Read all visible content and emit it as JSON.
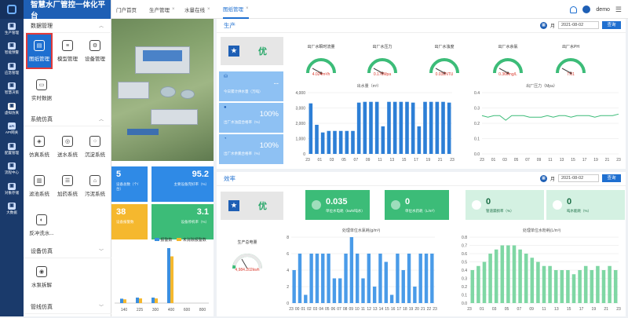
{
  "app_title": "智慧水厂管控一体化平台",
  "iconbar": [
    "生产管理",
    "智能预警",
    "应急管理",
    "智慧决策",
    "虚拟仿真",
    "API网关",
    "配置管理",
    "流程中心",
    "对象存储",
    "大数据"
  ],
  "menu": {
    "sec1": "数据管理",
    "sec1_items": [
      "图纸管理",
      "模型管理",
      "设备管理",
      "实时数据"
    ],
    "sec2": "系统仿真",
    "sec2_items": [
      "仿真系统",
      "送水系统",
      "沉淀系统",
      "滤池系统",
      "加药系统",
      "污泥系统",
      "反冲洗水..."
    ],
    "sec3": "设备仿真",
    "sec3_items": [
      "水泵拆解"
    ],
    "sec4": "管线仿真"
  },
  "tabs": [
    "门户首页",
    "生产管理",
    "水量在线",
    "图纸管理"
  ],
  "user": "demo",
  "left_cards": [
    {
      "value": "5",
      "label": "设备总数（个/台）",
      "color": "#2f8ae6"
    },
    {
      "value": "95.2",
      "label": "主要设备完好率（%）",
      "color": "#2f8ae6"
    },
    {
      "value": "38",
      "label": "设备报警数",
      "color": "#f5b82e"
    },
    {
      "value": "3.1",
      "label": "设备停机率（%）",
      "color": "#3cbc78"
    }
  ],
  "left_chart": {
    "legend": [
      "报警数",
      "未消除报警数"
    ],
    "x": [
      "140",
      "225",
      "300",
      "400",
      "600",
      "800"
    ],
    "bars": [
      8,
      10,
      10,
      100,
      0,
      0
    ]
  },
  "prod": {
    "title": "生产",
    "unit": "月",
    "date": "2021-08-02",
    "query": "查询",
    "grade": "优",
    "cards": [
      {
        "value": "--",
        "label": "今日累计供水量（万吨）"
      },
      {
        "value": "100%",
        "label": "出厂水浊度合格率（%）"
      },
      {
        "value": "100%",
        "label": "出厂水余氯合格率（%）"
      }
    ],
    "gauges": [
      {
        "title": "出厂水瞬时流量",
        "value": "4.024m³/h"
      },
      {
        "title": "出厂水压力",
        "value": "0.170Mpa"
      },
      {
        "title": "出厂水浊度",
        "value": "0.032NTU"
      },
      {
        "title": "出厂水余氯",
        "value": "0.360mg/L"
      },
      {
        "title": "出厂水PH",
        "value": "7.01"
      }
    ]
  },
  "eff": {
    "title": "效率",
    "unit": "月",
    "date": "2021-08-02",
    "query": "查询",
    "grade": "优",
    "cards": [
      {
        "value": "0.035",
        "label": "单位水电耗（kwh/吨水）"
      },
      {
        "value": "0",
        "label": "单位水药耗（L/m³）"
      },
      {
        "value": "0",
        "label": "管道漏损率（%）"
      },
      {
        "value": "0",
        "label": "吨水能耗（%）"
      }
    ],
    "gauge": {
      "title": "生产总电量",
      "value": "4,984.202kwh"
    }
  },
  "chart_data": [
    {
      "type": "bar",
      "title": "出水量（m³）",
      "categories": [
        "23",
        "01",
        "03",
        "05",
        "07",
        "09",
        "11",
        "13",
        "15",
        "17",
        "19",
        "21",
        "23"
      ],
      "values": [
        3300,
        1900,
        1400,
        1500,
        1500,
        1500,
        1500,
        1500,
        3350,
        3400,
        3400,
        3400,
        1800,
        3400,
        3400,
        3400,
        3400,
        3350,
        1800,
        3400,
        3400,
        3400,
        3400,
        3350
      ],
      "ylim": [
        0,
        4000
      ]
    },
    {
      "type": "line",
      "title": "出厂压力（Mpa）",
      "categories": [
        "23",
        "01",
        "03",
        "05",
        "07",
        "09",
        "11",
        "13",
        "15",
        "17",
        "19",
        "21",
        "23"
      ],
      "ylim": [
        0,
        0.4
      ]
    },
    {
      "type": "bar",
      "title": "处理单位水氯耗(g/m³)",
      "categories": [
        "23",
        "00",
        "01",
        "02",
        "03",
        "04",
        "05",
        "06",
        "07",
        "08",
        "09",
        "10",
        "11",
        "12",
        "13",
        "14",
        "15",
        "16",
        "17",
        "18",
        "19",
        "20",
        "21",
        "22",
        "23"
      ],
      "values": [
        4,
        6,
        1,
        6,
        6,
        6,
        6,
        3,
        3,
        6,
        8,
        6,
        3,
        6,
        2,
        6,
        5,
        1,
        6,
        4,
        6,
        2,
        6,
        6,
        6
      ],
      "ylim": [
        0,
        8
      ]
    },
    {
      "type": "bar",
      "title": "处理单位水粉耗(L/m³)",
      "categories": [
        "23",
        "01",
        "03",
        "05",
        "07",
        "09",
        "11",
        "13",
        "15",
        "17",
        "19",
        "21",
        "23"
      ],
      "values": [
        0.4,
        0.45,
        0.5,
        0.6,
        0.65,
        0.7,
        0.7,
        0.7,
        0.65,
        0.6,
        0.55,
        0.5,
        0.45,
        0.45,
        0.4,
        0.4,
        0.4,
        0.35,
        0.4,
        0.45,
        0.4,
        0.45,
        0.4,
        0.45,
        0.4
      ],
      "ylim": [
        0,
        0.8
      ]
    }
  ]
}
